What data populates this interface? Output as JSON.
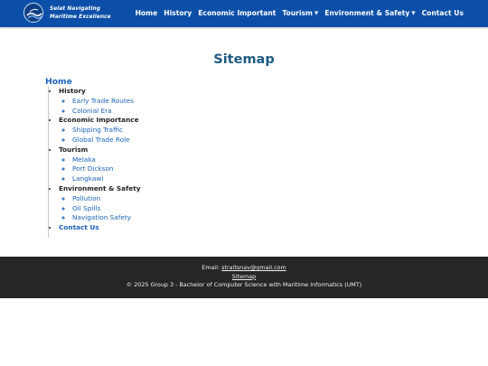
{
  "brand": {
    "line1": "Selat Navigating",
    "line2": "Maritime Excellence"
  },
  "nav": {
    "items": [
      {
        "label": "Home",
        "caret": ""
      },
      {
        "label": "History",
        "caret": ""
      },
      {
        "label": "Economic Important",
        "caret": ""
      },
      {
        "label": "Tourism",
        "caret": "▼"
      },
      {
        "label": "Environment & Safety",
        "caret": "▼"
      },
      {
        "label": "Contact Us",
        "caret": ""
      }
    ]
  },
  "page": {
    "title": "Sitemap",
    "home_link": "Home"
  },
  "sitemap": {
    "history": {
      "label": "History",
      "children": [
        "Early Trade Routes",
        "Colonial Era"
      ]
    },
    "economic": {
      "label": "Economic Importance",
      "children": [
        "Shipping Traffic",
        "Global Trade Role"
      ]
    },
    "tourism": {
      "label": "Tourism",
      "children": [
        "Melaka",
        "Port Dickson",
        "Langkawi"
      ]
    },
    "environment": {
      "label": "Environment & Safety",
      "children": [
        "Pollution",
        "Oil Spills",
        "Navigation Safety"
      ]
    },
    "contact": {
      "label": "Contact Us"
    }
  },
  "footer": {
    "email_prefix": "Email: ",
    "email": "straitsnav@gmail.com",
    "sitemap_link": "Sitemap",
    "copyright": "© 2025 Group 3 - Bachelor of Computer Science with Maritime Informatics (UMT)"
  },
  "colors": {
    "header_bg": "#0b4fa8",
    "title": "#1d5a80",
    "link": "#1a63b8",
    "footer_bg": "#262626"
  },
  "icons": {
    "logo": "ship-wave-logo-icon",
    "dropdown": "caret-down-icon"
  }
}
